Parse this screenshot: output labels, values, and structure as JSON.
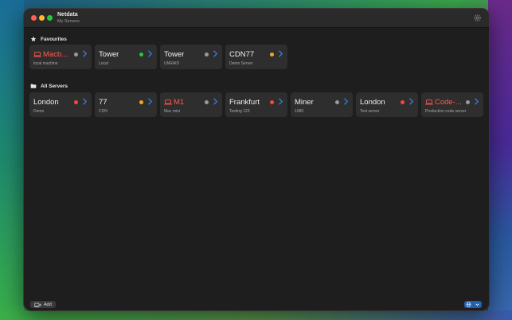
{
  "window": {
    "title": "Netdata",
    "subtitle": "My Servers"
  },
  "favourites": {
    "label": "Favourites",
    "servers": [
      {
        "name": "Macb...",
        "description": "local machine",
        "status": "gray",
        "alert": true
      },
      {
        "name": "Tower",
        "description": "Local",
        "status": "green",
        "alert": false
      },
      {
        "name": "Tower",
        "description": "UNRAID",
        "status": "gray",
        "alert": false
      },
      {
        "name": "CDN77",
        "description": "Demo Server",
        "status": "orange",
        "alert": false
      }
    ]
  },
  "all_servers": {
    "label": "All Servers",
    "servers": [
      {
        "name": "London",
        "description": "Demo",
        "status": "red",
        "alert": false
      },
      {
        "name": "77",
        "description": "CDN",
        "status": "orange",
        "alert": false
      },
      {
        "name": "M1",
        "description": "Mac mini",
        "status": "gray",
        "alert": true
      },
      {
        "name": "Frankfurt",
        "description": "Testing 123",
        "status": "red",
        "alert": false
      },
      {
        "name": "Miner",
        "description": "1080",
        "status": "gray",
        "alert": false
      },
      {
        "name": "London",
        "description": "Test server",
        "status": "red",
        "alert": false
      },
      {
        "name": "Code-...",
        "description": "Production code server",
        "status": "gray",
        "alert": true
      }
    ]
  },
  "footer": {
    "add_label": "Add"
  },
  "icons": {
    "settings": "gear-icon",
    "favourites": "star-icon",
    "all_servers": "folder-icon",
    "alert_machine": "laptop-icon",
    "open": "chevron-right-icon",
    "add": "add-server-icon",
    "account": "globe-icon"
  },
  "colors": {
    "status_green": "#28c840",
    "status_gray": "#9a9a9a",
    "status_orange": "#f5a623",
    "status_red": "#ff453a",
    "alert_text": "#ff5a4d",
    "accent": "#1f5fb4",
    "chevron": "#3a8bff"
  }
}
